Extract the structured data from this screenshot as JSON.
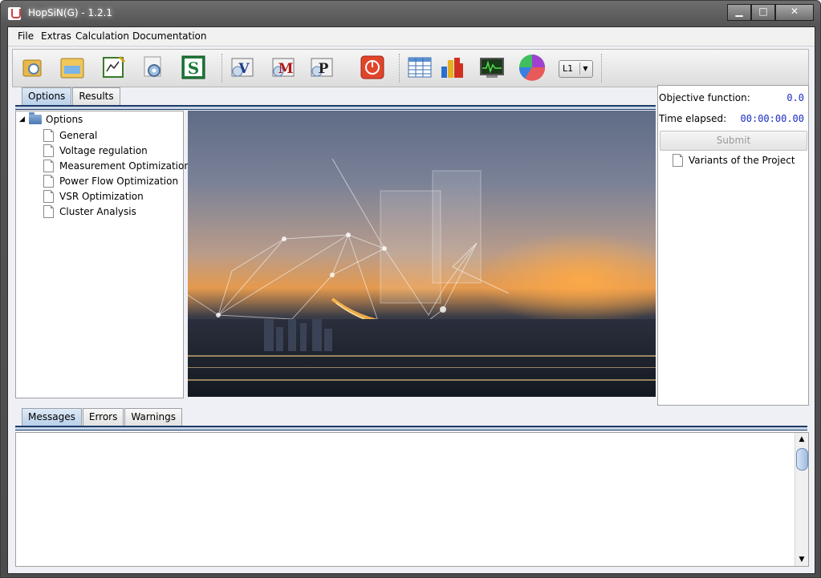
{
  "window": {
    "title": "HopSiN(G) - 1.2.1",
    "buttons": {
      "minimize": "▁",
      "maximize": "□",
      "close": "✕"
    }
  },
  "menubar": {
    "items": [
      "File",
      "Extras",
      "Calculation",
      "Documentation"
    ]
  },
  "toolbar": {
    "buttons": [
      {
        "icon": "open-folder-icon"
      },
      {
        "icon": "project-folder-icon"
      },
      {
        "icon": "edit-chart-icon"
      },
      {
        "icon": "settings-gear-icon"
      },
      {
        "icon": "s-solver-icon",
        "text": "S"
      },
      {
        "icon": "v-optimization-icon",
        "text": "V"
      },
      {
        "icon": "m-optimization-icon",
        "text": "M"
      },
      {
        "icon": "p-optimization-icon",
        "text": "P"
      },
      {
        "icon": "power-stop-icon"
      },
      {
        "icon": "table-icon"
      },
      {
        "icon": "bar-chart-icon"
      },
      {
        "icon": "monitor-signal-icon"
      },
      {
        "icon": "pie-chart-icon"
      }
    ],
    "combo_value": "L1",
    "combo_arrow": "▼"
  },
  "top_tabs": [
    {
      "label": "Options",
      "active": true
    },
    {
      "label": "Results",
      "active": false
    }
  ],
  "tree": {
    "root": "Options",
    "expander": "◢",
    "children": [
      "General",
      "Voltage regulation",
      "Measurement Optimization",
      "Power Flow Optimization",
      "VSR Optimization",
      "Cluster Analysis"
    ]
  },
  "side_panel": {
    "objective_label": "Objective function:",
    "objective_value": "0.0",
    "time_label": "Time elapsed:",
    "time_value": "00:00:00.00",
    "submit_label": "Submit",
    "variants_label": "Variants of the Project"
  },
  "bottom_tabs": [
    {
      "label": "Messages",
      "active": true
    },
    {
      "label": "Errors",
      "active": false
    },
    {
      "label": "Warnings",
      "active": false
    }
  ],
  "scrollbar": {
    "up": "▲",
    "down": "▼"
  },
  "colors": {
    "accent": "#1e3b66",
    "value_blue": "#1a2cc4",
    "tab_active": "#b9d1ea"
  }
}
